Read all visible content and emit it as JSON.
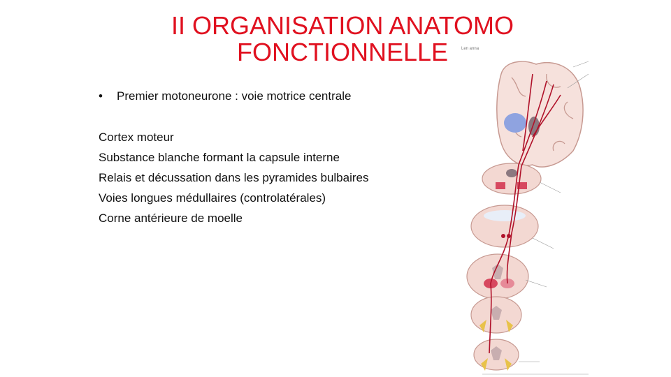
{
  "slide": {
    "title_line1": "II ORGANISATION ANATOMO",
    "title_line2": "FONCTIONNELLE",
    "bullet": "Premier motoneurone  : voie motrice centrale",
    "bullet_marker": "•",
    "lines": [
      "Cortex moteur",
      "Substance  blanche  formant  la capsule  interne",
      "Relais  et décussation  dans les pyramides  bulbaires",
      "Voies longues  médullaires  (controlatérales)",
      "Corne  antérieure  de moelle"
    ]
  },
  "figure": {
    "caption_fragment": "Len anna",
    "colors": {
      "tract": "#b0122a",
      "tissue": "#f3d8d2",
      "ventricle": "#8fa3e0",
      "nerve": "#e8c24a"
    }
  },
  "colors": {
    "title": "#e0101f",
    "text": "#111111",
    "background": "#ffffff"
  }
}
